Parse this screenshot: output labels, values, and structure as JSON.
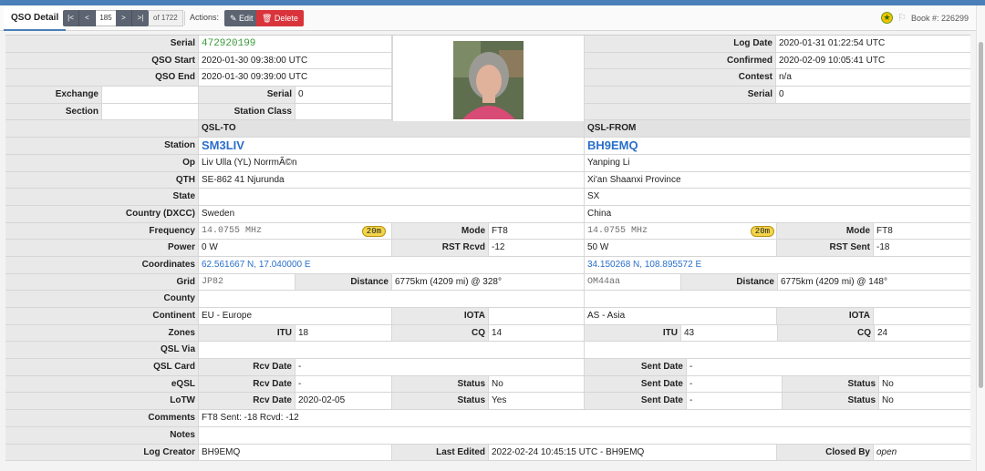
{
  "toolbar": {
    "tab": "QSO Detail",
    "pager": {
      "first": "|<",
      "prev": "<",
      "current": "185",
      "next": ">",
      "last": ">|",
      "of": "of 1722"
    },
    "actions_label": "Actions:",
    "edit": "✎ Edit",
    "delete": "🗑 Delete",
    "book": "Book #: 226299"
  },
  "top": {
    "serial_label": "Serial",
    "serial_value": "472920199",
    "qso_start_label": "QSO Start",
    "qso_start": "2020-01-30 09:38:00 UTC",
    "qso_end_label": "QSO End",
    "qso_end": "2020-01-30 09:39:00 UTC",
    "exchange_label": "Exchange",
    "exchange_value": "",
    "exchange_serial_label": "Serial",
    "exchange_serial": "0",
    "section_label": "Section",
    "section_value": "",
    "station_class_label": "Station Class",
    "station_class": "",
    "log_date_label": "Log Date",
    "log_date": "2020-01-31 01:22:54 UTC",
    "confirmed_label": "Confirmed",
    "confirmed": "2020-02-09 10:05:41 UTC",
    "contest_label": "Contest",
    "contest": "n/a",
    "right_serial_label": "Serial",
    "right_serial": "0"
  },
  "headers": {
    "qsl_to": "QSL-TO",
    "qsl_from": "QSL-FROM"
  },
  "labels": {
    "station": "Station",
    "op": "Op",
    "qth": "QTH",
    "state": "State",
    "country": "Country (DXCC)",
    "frequency": "Frequency",
    "mode": "Mode",
    "power": "Power",
    "rst_rcvd": "RST Rcvd",
    "rst_sent": "RST Sent",
    "coordinates": "Coordinates",
    "grid": "Grid",
    "distance": "Distance",
    "county": "County",
    "continent": "Continent",
    "iota": "IOTA",
    "zones": "Zones",
    "itu": "ITU",
    "cq": "CQ",
    "qsl_via": "QSL Via",
    "qsl_card": "QSL Card",
    "rcv_date": "Rcv Date",
    "sent_date": "Sent Date",
    "eqsl": "eQSL",
    "lotw": "LoTW",
    "status": "Status",
    "comments": "Comments",
    "notes": "Notes",
    "log_creator": "Log Creator",
    "last_edited": "Last Edited",
    "closed_by": "Closed By"
  },
  "to": {
    "station": "SM3LIV",
    "op": "Liv Ulla (YL) NorrmÃ©n",
    "qth": "SE-862 41 Njurunda",
    "state": "",
    "country": "Sweden",
    "frequency": "14.0755 MHz",
    "band": "20m",
    "mode": "FT8",
    "power": "0 W",
    "rst_rcvd": "-12",
    "coordinates": "62.561667 N, 17.040000 E",
    "grid": "JP82",
    "distance": "6775km (4209 mi) @ 328°",
    "county": "",
    "continent": "EU - Europe",
    "iota": "",
    "itu": "18",
    "cq": "14",
    "qsl_via": "",
    "qsl_card_rcv": "-",
    "eqsl_rcv": "-",
    "eqsl_status": "No",
    "lotw_rcv": "2020-02-05",
    "lotw_status": "Yes"
  },
  "from": {
    "station": "BH9EMQ",
    "op": "Yanping Li",
    "qth": "Xi'an Shaanxi Province",
    "state": "SX",
    "country": "China",
    "frequency": "14.0755 MHz",
    "band": "20m",
    "mode": "FT8",
    "power": "50 W",
    "rst_sent": "-18",
    "coordinates": "34.150268 N, 108.895572 E",
    "grid": "OM44aa",
    "distance": "6775km (4209 mi) @ 148°",
    "county": "",
    "continent": "AS - Asia",
    "iota": "",
    "itu": "43",
    "cq": "24",
    "qsl_card_sent": "-",
    "eqsl_sent": "-",
    "eqsl_status": "No",
    "lotw_sent": "-",
    "lotw_status": "No"
  },
  "footer": {
    "comments": "FT8 Sent: -18 Rcvd: -12",
    "notes": "",
    "log_creator": "BH9EMQ",
    "last_edited": "2022-02-24 10:45:15 UTC - BH9EMQ",
    "closed_by": "open"
  },
  "icons": {
    "star": "star-badge-icon",
    "flag": "flag-icon",
    "photo": "operator-photo"
  }
}
